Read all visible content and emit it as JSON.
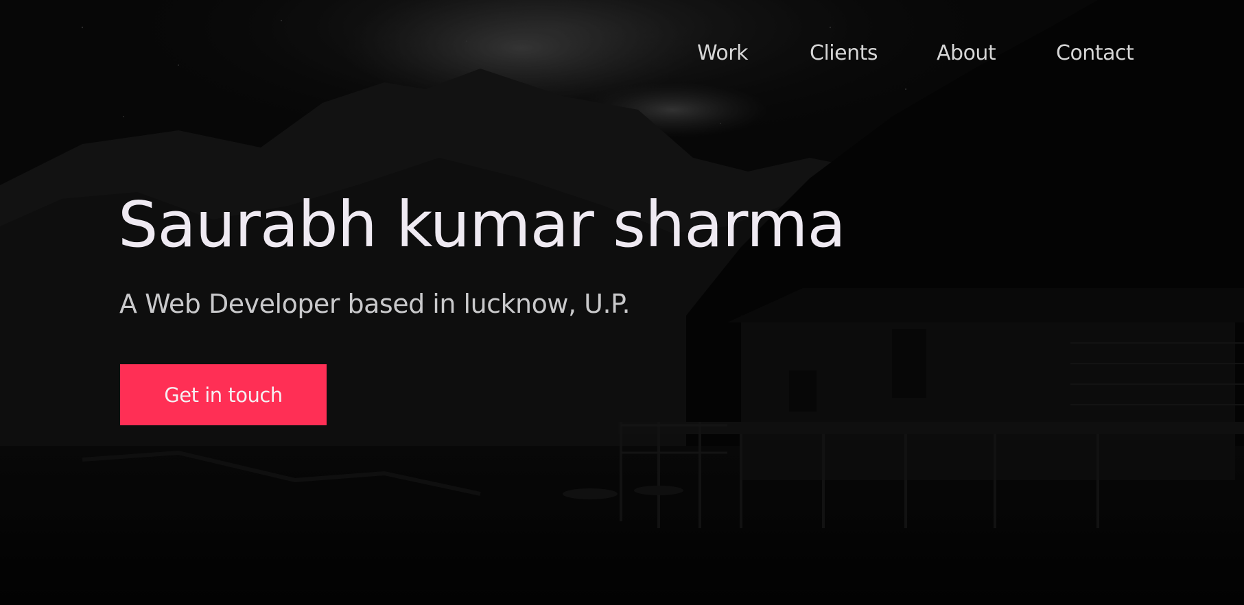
{
  "nav": {
    "items": [
      {
        "label": "Work"
      },
      {
        "label": "Clients"
      },
      {
        "label": "About"
      },
      {
        "label": "Contact"
      }
    ]
  },
  "hero": {
    "title": "Saurabh kumar sharma",
    "subtitle": "A Web Developer based in lucknow, U.P.",
    "cta_label": "Get in touch",
    "background_image": "night-mountain-lake-cabin"
  },
  "colors": {
    "accent": "#ff2f55",
    "background": "#050505",
    "title_text": "#efeaf2",
    "subtitle_text": "#c9c9cb",
    "nav_text": "#d6d6d6"
  }
}
